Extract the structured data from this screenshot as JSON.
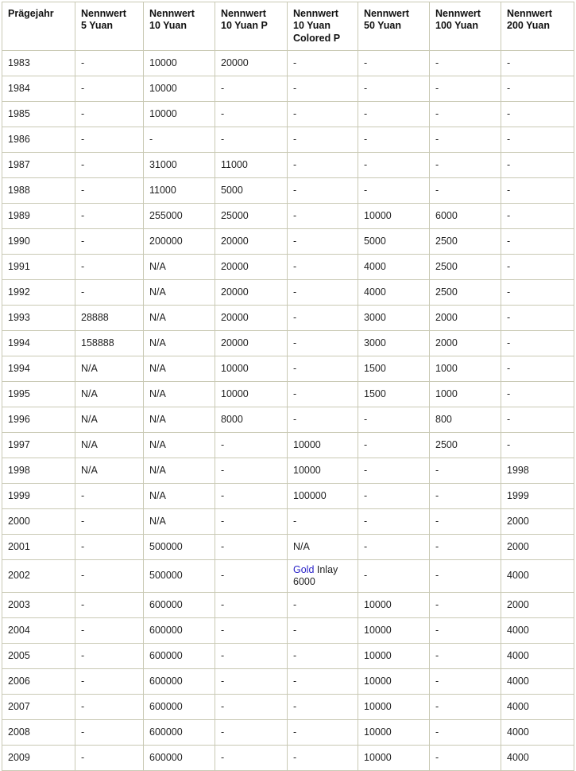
{
  "table": {
    "columns": [
      {
        "id": "year",
        "label": "Prägejahr"
      },
      {
        "id": "y5",
        "label": "Nennwert\n5 Yuan"
      },
      {
        "id": "y10",
        "label": "Nennwert\n10 Yuan"
      },
      {
        "id": "y10p",
        "label": "Nennwert\n10 Yuan P"
      },
      {
        "id": "y10cp",
        "label": "Nennwert\n10 Yuan\nColored P"
      },
      {
        "id": "y50",
        "label": "Nennwert\n50 Yuan"
      },
      {
        "id": "y100",
        "label": "Nennwert\n100 Yuan"
      },
      {
        "id": "y200",
        "label": "Nennwert\n200 Yuan"
      }
    ],
    "rows": [
      {
        "year": "1983",
        "y5": "-",
        "y10": "10000",
        "y10p": "20000",
        "y10cp": "-",
        "y50": "-",
        "y100": "-",
        "y200": "-"
      },
      {
        "year": "1984",
        "y5": "-",
        "y10": "10000",
        "y10p": "-",
        "y10cp": "-",
        "y50": "-",
        "y100": "-",
        "y200": "-"
      },
      {
        "year": "1985",
        "y5": "-",
        "y10": "10000",
        "y10p": "-",
        "y10cp": "-",
        "y50": "-",
        "y100": "-",
        "y200": "-"
      },
      {
        "year": "1986",
        "y5": "-",
        "y10": "-",
        "y10p": "-",
        "y10cp": "-",
        "y50": "-",
        "y100": "-",
        "y200": "-"
      },
      {
        "year": "1987",
        "y5": "-",
        "y10": "31000",
        "y10p": "11000",
        "y10cp": "-",
        "y50": "-",
        "y100": "-",
        "y200": "-"
      },
      {
        "year": "1988",
        "y5": "-",
        "y10": "11000",
        "y10p": "5000",
        "y10cp": "-",
        "y50": "-",
        "y100": "-",
        "y200": "-"
      },
      {
        "year": "1989",
        "y5": "-",
        "y10": "255000",
        "y10p": "25000",
        "y10cp": "-",
        "y50": "10000",
        "y100": "6000",
        "y200": "-"
      },
      {
        "year": "1990",
        "y5": "-",
        "y10": "200000",
        "y10p": "20000",
        "y10cp": "-",
        "y50": "5000",
        "y100": "2500",
        "y200": "-"
      },
      {
        "year": "1991",
        "y5": "-",
        "y10": "N/A",
        "y10p": "20000",
        "y10cp": "-",
        "y50": "4000",
        "y100": "2500",
        "y200": "-"
      },
      {
        "year": "1992",
        "y5": "-",
        "y10": "N/A",
        "y10p": "20000",
        "y10cp": "-",
        "y50": "4000",
        "y100": "2500",
        "y200": "-"
      },
      {
        "year": "1993",
        "y5": "28888",
        "y10": "N/A",
        "y10p": "20000",
        "y10cp": "-",
        "y50": "3000",
        "y100": "2000",
        "y200": "-"
      },
      {
        "year": "1994",
        "y5": "158888",
        "y10": "N/A",
        "y10p": "20000",
        "y10cp": "-",
        "y50": "3000",
        "y100": "2000",
        "y200": "-"
      },
      {
        "year": "1994",
        "y5": "N/A",
        "y10": "N/A",
        "y10p": "10000",
        "y10cp": "-",
        "y50": "1500",
        "y100": "1000",
        "y200": "-"
      },
      {
        "year": "1995",
        "y5": "N/A",
        "y10": "N/A",
        "y10p": "10000",
        "y10cp": "-",
        "y50": "1500",
        "y100": "1000",
        "y200": "-"
      },
      {
        "year": "1996",
        "y5": "N/A",
        "y10": "N/A",
        "y10p": "8000",
        "y10cp": "-",
        "y50": "-",
        "y100": "800",
        "y200": "-"
      },
      {
        "year": "1997",
        "y5": "N/A",
        "y10": "N/A",
        "y10p": "-",
        "y10cp": "10000",
        "y50": "-",
        "y100": "2500",
        "y200": "-"
      },
      {
        "year": "1998",
        "y5": "N/A",
        "y10": "N/A",
        "y10p": "-",
        "y10cp": "10000",
        "y50": "-",
        "y100": "-",
        "y200": "1998"
      },
      {
        "year": "1999",
        "y5": "-",
        "y10": "N/A",
        "y10p": "-",
        "y10cp": "100000",
        "y50": "-",
        "y100": "-",
        "y200": "1999"
      },
      {
        "year": "2000",
        "y5": "-",
        "y10": "N/A",
        "y10p": "-",
        "y10cp": "-",
        "y50": "-",
        "y100": "-",
        "y200": "2000"
      },
      {
        "year": "2001",
        "y5": "-",
        "y10": "500000",
        "y10p": "-",
        "y10cp": "N/A",
        "y50": "-",
        "y100": "-",
        "y200": "2000"
      },
      {
        "year": "2002",
        "y5": "-",
        "y10": "500000",
        "y10p": "-",
        "y10cp": {
          "link_text": "Gold",
          "after_link": " Inlay",
          "second_line": "6000"
        },
        "y50": "-",
        "y100": "-",
        "y200": "4000",
        "tall": true
      },
      {
        "year": "2003",
        "y5": "-",
        "y10": "600000",
        "y10p": "-",
        "y10cp": "-",
        "y50": "10000",
        "y100": "-",
        "y200": "2000"
      },
      {
        "year": "2004",
        "y5": "-",
        "y10": "600000",
        "y10p": "-",
        "y10cp": "-",
        "y50": "10000",
        "y100": "-",
        "y200": "4000"
      },
      {
        "year": "2005",
        "y5": "-",
        "y10": "600000",
        "y10p": "-",
        "y10cp": "-",
        "y50": "10000",
        "y100": "-",
        "y200": "4000"
      },
      {
        "year": "2006",
        "y5": "-",
        "y10": "600000",
        "y10p": "-",
        "y10cp": "-",
        "y50": "10000",
        "y100": "-",
        "y200": "4000"
      },
      {
        "year": "2007",
        "y5": "-",
        "y10": "600000",
        "y10p": "-",
        "y10cp": "-",
        "y50": "10000",
        "y100": "-",
        "y200": "4000"
      },
      {
        "year": "2008",
        "y5": "-",
        "y10": "600000",
        "y10p": "-",
        "y10cp": "-",
        "y50": "10000",
        "y100": "-",
        "y200": "4000"
      },
      {
        "year": "2009",
        "y5": "-",
        "y10": "600000",
        "y10p": "-",
        "y10cp": "-",
        "y50": "10000",
        "y100": "-",
        "y200": "4000"
      }
    ]
  },
  "colors": {
    "border": "#c9c9b4",
    "link": "#2b24c8",
    "text": "#1f1f1f",
    "header_text": "#111111",
    "background": "#ffffff"
  }
}
